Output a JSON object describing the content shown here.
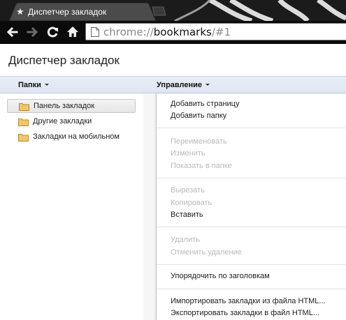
{
  "browser": {
    "tab": {
      "title": "Диспетчер закладок"
    },
    "url": {
      "scheme": "chrome://",
      "host": "bookmarks",
      "path": "/#1"
    }
  },
  "page": {
    "title": "Диспетчер закладок",
    "folders_menu_label": "Папки",
    "organize_menu_label": "Управление"
  },
  "tree": {
    "items": [
      {
        "label": "Панель закладок",
        "selected": true
      },
      {
        "label": "Другие закладки"
      },
      {
        "label": "Закладки на мобильном"
      }
    ]
  },
  "organize_menu": {
    "items": [
      {
        "label": "Добавить страницу",
        "enabled": true
      },
      {
        "label": "Добавить папку",
        "enabled": true
      },
      {
        "label": "Переименовать",
        "enabled": false
      },
      {
        "label": "Изменить",
        "enabled": false
      },
      {
        "label": "Показать в папке",
        "enabled": false
      },
      {
        "label": "Вырезать",
        "enabled": false
      },
      {
        "label": "Копировать",
        "enabled": false
      },
      {
        "label": "Вставить",
        "enabled": true
      },
      {
        "label": "Удалить",
        "enabled": false
      },
      {
        "label": "Отменить удаление",
        "enabled": false
      },
      {
        "label": "Упорядочить по заголовкам",
        "enabled": true
      },
      {
        "label": "Импортировать закладки из файла HTML...",
        "enabled": true
      },
      {
        "label": "Экспортировать закладки в файл HTML...",
        "enabled": true
      }
    ]
  },
  "icons": {
    "tab": "star-icon",
    "back": "back-arrow-icon",
    "forward": "forward-arrow-icon",
    "reload": "reload-icon",
    "home": "home-icon",
    "page": "page-icon",
    "folder": "folder-icon"
  },
  "colors": {
    "header_bar": "#e3e9f5",
    "disabled_text": "#b9b9b9",
    "folder": "#f2c76b"
  }
}
